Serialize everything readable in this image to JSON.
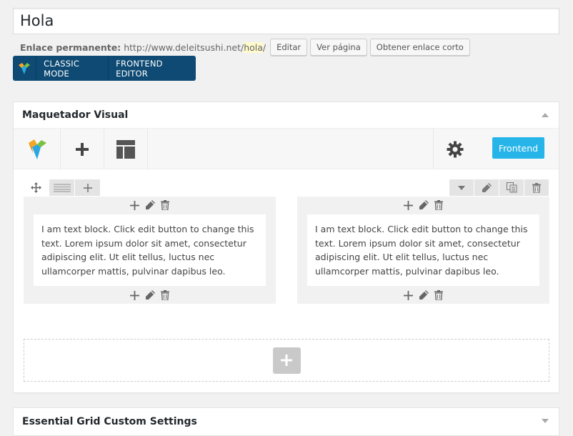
{
  "post": {
    "title": "Hola"
  },
  "permalink": {
    "label": "Enlace permanente:",
    "base_url": "http://www.deleitsushi.net/",
    "slug": "hola",
    "suffix": "/",
    "edit_label": "Editar",
    "view_label": "Ver página",
    "shortlink_label": "Obtener enlace corto"
  },
  "modebar": {
    "classic_label": "CLASSIC MODE",
    "frontend_label": "FRONTEND EDITOR"
  },
  "builder": {
    "title": "Maquetador Visual",
    "frontend_button": "Frontend",
    "columns": [
      {
        "text": "I am text block. Click edit button to change this text. Lorem ipsum dolor sit amet, consectetur adipiscing elit. Ut elit tellus, luctus nec ullamcorper mattis, pulvinar dapibus leo."
      },
      {
        "text": "I am text block. Click edit button to change this text. Lorem ipsum dolor sit amet, consectetur adipiscing elit. Ut elit tellus, luctus nec ullamcorper mattis, pulvinar dapibus leo."
      }
    ]
  },
  "essential_grid": {
    "title": "Essential Grid Custom Settings"
  },
  "colors": {
    "modebar": "#0e4a73",
    "frontend_button": "#27b5e9",
    "slug_highlight": "#fffbcc"
  },
  "icons": [
    "vc-logo-icon",
    "plus-icon",
    "layout-icon",
    "gear-icon",
    "move-icon",
    "columns-icon",
    "chevron-down-icon",
    "pencil-icon",
    "copy-icon",
    "trash-icon"
  ]
}
